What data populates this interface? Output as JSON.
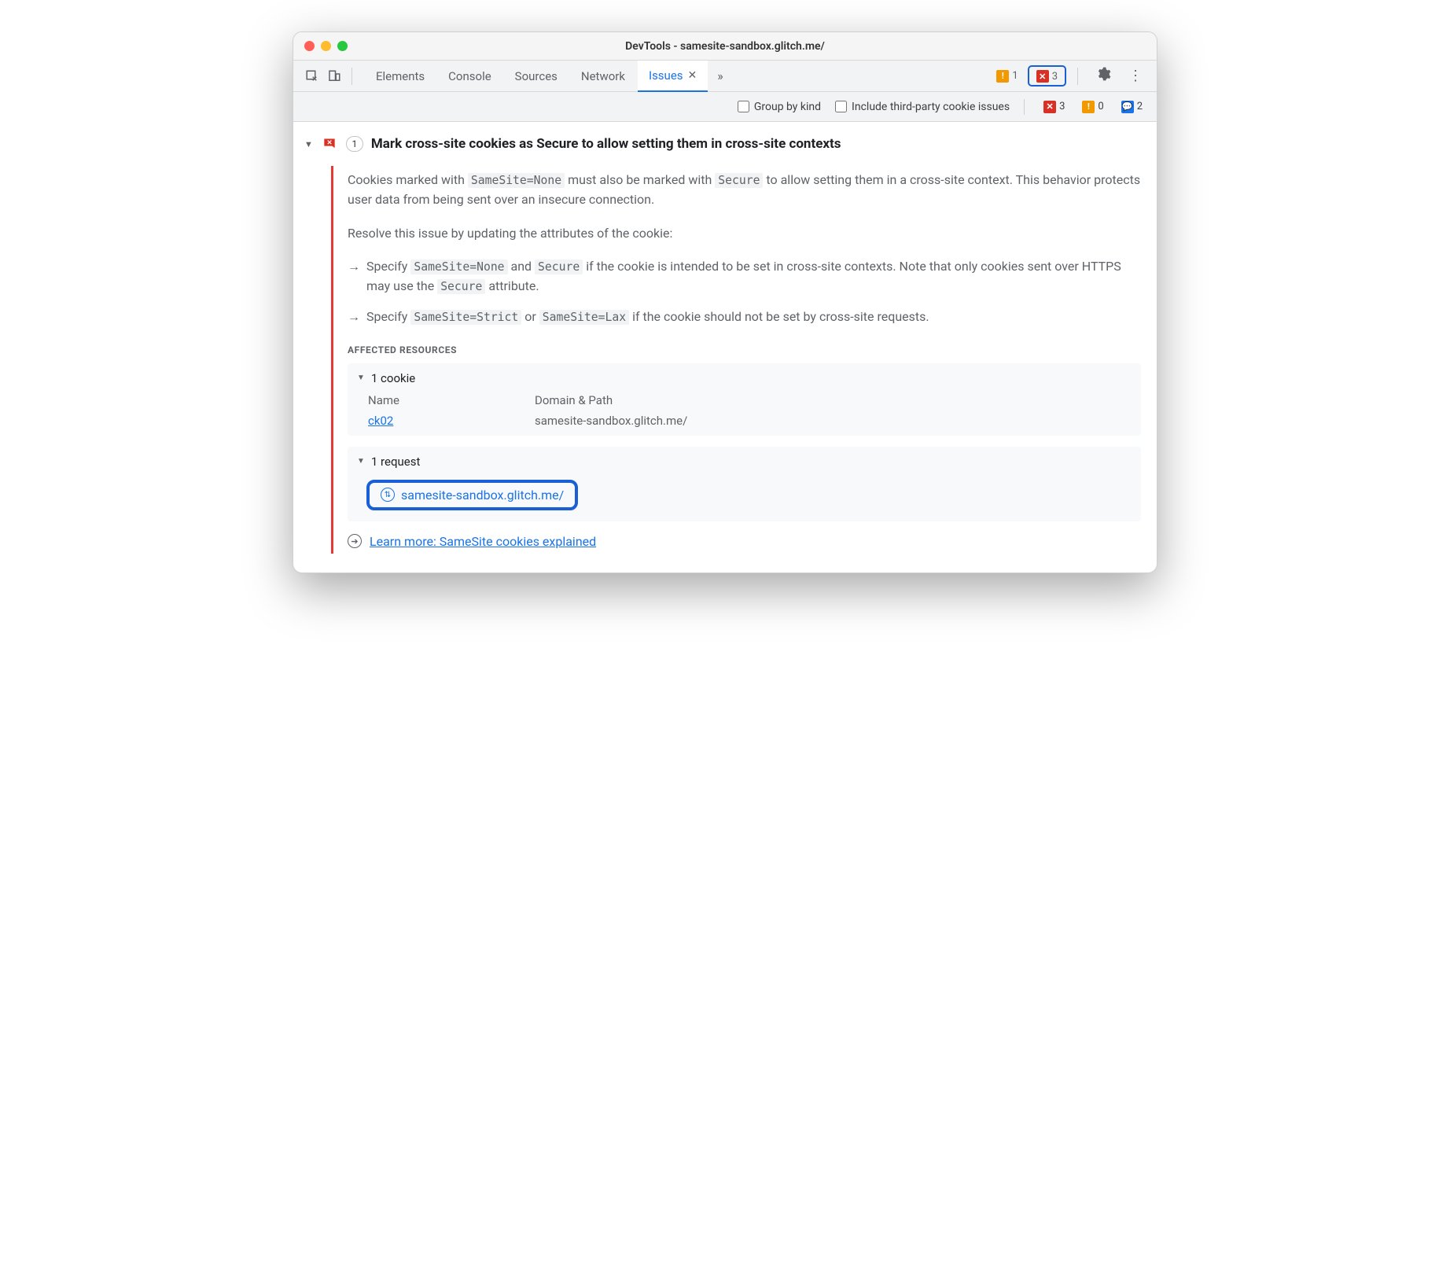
{
  "window": {
    "title": "DevTools - samesite-sandbox.glitch.me/"
  },
  "tabs": {
    "items": [
      "Elements",
      "Console",
      "Sources",
      "Network"
    ],
    "active": "Issues"
  },
  "toolbar_status": {
    "warn_count": "1",
    "error_count": "3"
  },
  "subbar": {
    "group_by_kind": "Group by kind",
    "third_party": "Include third-party cookie issues",
    "err": "3",
    "warn": "0",
    "info": "2"
  },
  "issue": {
    "count": "1",
    "title": "Mark cross-site cookies as Secure to allow setting them in cross-site contexts",
    "p1_a": "Cookies marked with ",
    "p1_code1": "SameSite=None",
    "p1_b": " must also be marked with ",
    "p1_code2": "Secure",
    "p1_c": " to allow setting them in a cross-site context. This behavior protects user data from being sent over an insecure connection.",
    "p2": "Resolve this issue by updating the attributes of the cookie:",
    "b1_a": "Specify ",
    "b1_c1": "SameSite=None",
    "b1_b": " and ",
    "b1_c2": "Secure",
    "b1_c": " if the cookie is intended to be set in cross-site contexts. Note that only cookies sent over HTTPS may use the ",
    "b1_c3": "Secure",
    "b1_d": " attribute.",
    "b2_a": "Specify ",
    "b2_c1": "SameSite=Strict",
    "b2_b": " or ",
    "b2_c2": "SameSite=Lax",
    "b2_c": " if the cookie should not be set by cross-site requests.",
    "affected_heading": "AFFECTED RESOURCES",
    "cookie": {
      "head": "1 cookie",
      "col_name": "Name",
      "col_domain": "Domain & Path",
      "name": "ck02",
      "domain": "samesite-sandbox.glitch.me/"
    },
    "request": {
      "head": "1 request",
      "url": "samesite-sandbox.glitch.me/"
    },
    "learn": "Learn more: SameSite cookies explained"
  }
}
